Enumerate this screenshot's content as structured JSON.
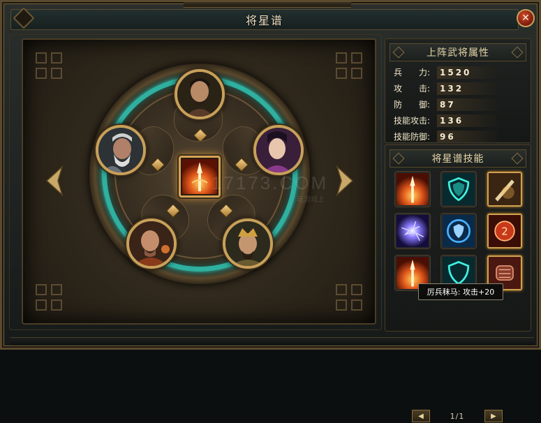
{
  "window": {
    "title": "将星谱",
    "close_label": "✕"
  },
  "attributes_panel": {
    "title": "上阵武将属性",
    "rows": [
      {
        "label": "兵　　力:",
        "value": "1520"
      },
      {
        "label": "攻　　击:",
        "value": "132"
      },
      {
        "label": "防　　御:",
        "value": "87"
      },
      {
        "label": "技能攻击:",
        "value": "136"
      },
      {
        "label": "技能防御:",
        "value": "96"
      }
    ]
  },
  "skills_panel": {
    "title": "将星谱技能",
    "skills": [
      {
        "icon": "spear-fire-icon",
        "gold": false
      },
      {
        "icon": "teal-shield-icon",
        "gold": false
      },
      {
        "icon": "sword-strike-icon",
        "gold": true
      },
      {
        "icon": "lightning-orb-icon",
        "gold": false
      },
      {
        "icon": "blue-shield-icon",
        "gold": false
      },
      {
        "icon": "fire-rune-icon",
        "gold": true
      },
      {
        "icon": "spear-fire-icon",
        "gold": false
      },
      {
        "icon": "teal-shield-icon",
        "gold": false
      },
      {
        "icon": "armor-fist-icon",
        "gold": true
      }
    ],
    "page": "1/1"
  },
  "tooltip": {
    "text": "厉兵秣马: 攻击+20"
  },
  "stage": {
    "center_skill_icon": "spear-fire-icon",
    "generals": [
      {
        "name": "general-top"
      },
      {
        "name": "general-left"
      },
      {
        "name": "general-right"
      },
      {
        "name": "general-bottom-left"
      },
      {
        "name": "general-bottom-right"
      }
    ],
    "watermark": "17173.COM",
    "watermark_sub": "玩游戏上"
  },
  "colors": {
    "accent_teal": "#2fb0a0",
    "gold": "#c8a05a",
    "close_red": "#d24a2a"
  }
}
